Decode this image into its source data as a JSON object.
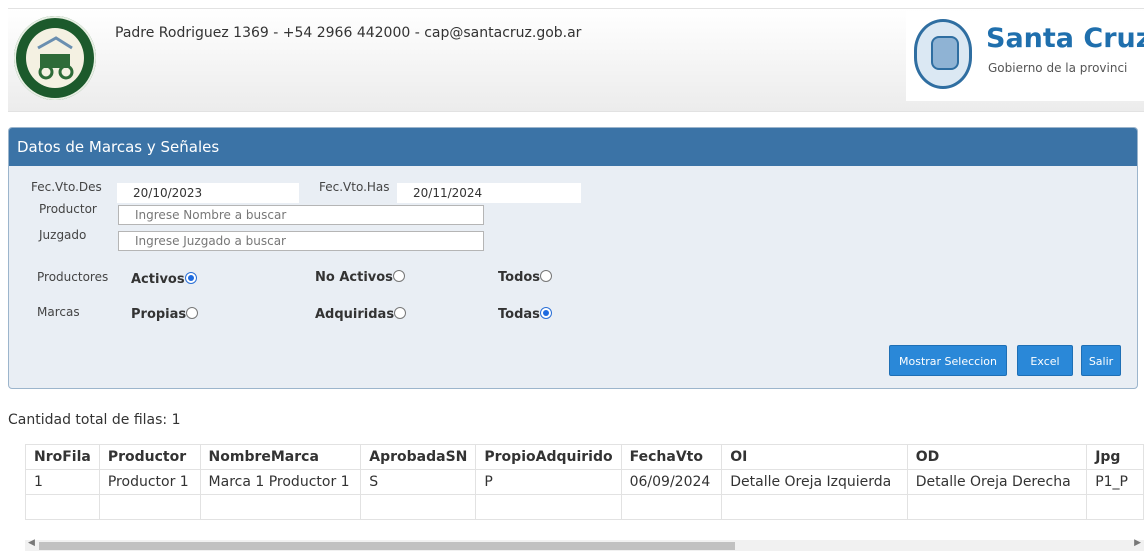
{
  "header": {
    "contact": "Padre Rodriguez 1369 - +54 2966 442000 - cap@santacruz.gob.ar",
    "gov_name": "Santa Cruz",
    "gov_sub": "Gobierno de la provinci"
  },
  "panel": {
    "title": "Datos de Marcas y Señales",
    "fec_vto_des_label": "Fec.Vto.Des",
    "fec_vto_des_value": "20/10/2023",
    "fec_vto_has_label": "Fec.Vto.Has",
    "fec_vto_has_value": "20/11/2024",
    "productor_label": "Productor",
    "productor_placeholder": "Ingrese Nombre a buscar",
    "juzgado_label": "Juzgado",
    "juzgado_placeholder": "Ingrese Juzgado a buscar",
    "productores": {
      "label": "Productores",
      "options": [
        {
          "label": "Activos",
          "selected": true
        },
        {
          "label": "No Activos",
          "selected": false
        },
        {
          "label": "Todos",
          "selected": false
        }
      ]
    },
    "marcas": {
      "label": "Marcas",
      "options": [
        {
          "label": "Propias",
          "selected": false
        },
        {
          "label": "Adquiridas",
          "selected": false
        },
        {
          "label": "Todas",
          "selected": true
        }
      ]
    },
    "buttons": {
      "mostrar": "Mostrar Seleccion",
      "excel": "Excel",
      "salir": "Salir"
    }
  },
  "results": {
    "count_text": "Cantidad total de filas: 1",
    "columns": [
      "NroFila",
      "Productor",
      "NombreMarca",
      "AprobadaSN",
      "PropioAdquirido",
      "FechaVto",
      "OI",
      "OD",
      "Jpg"
    ],
    "rows": [
      [
        "1",
        "Productor 1",
        "Marca 1 Productor 1",
        "S",
        "P",
        "06/09/2024",
        "Detalle Oreja Izquierda",
        "Detalle Oreja Derecha",
        "P1_P"
      ]
    ]
  },
  "colors": {
    "panel_header": "#3b73a6",
    "button": "#2a88d8",
    "brand": "#1f6fad"
  }
}
